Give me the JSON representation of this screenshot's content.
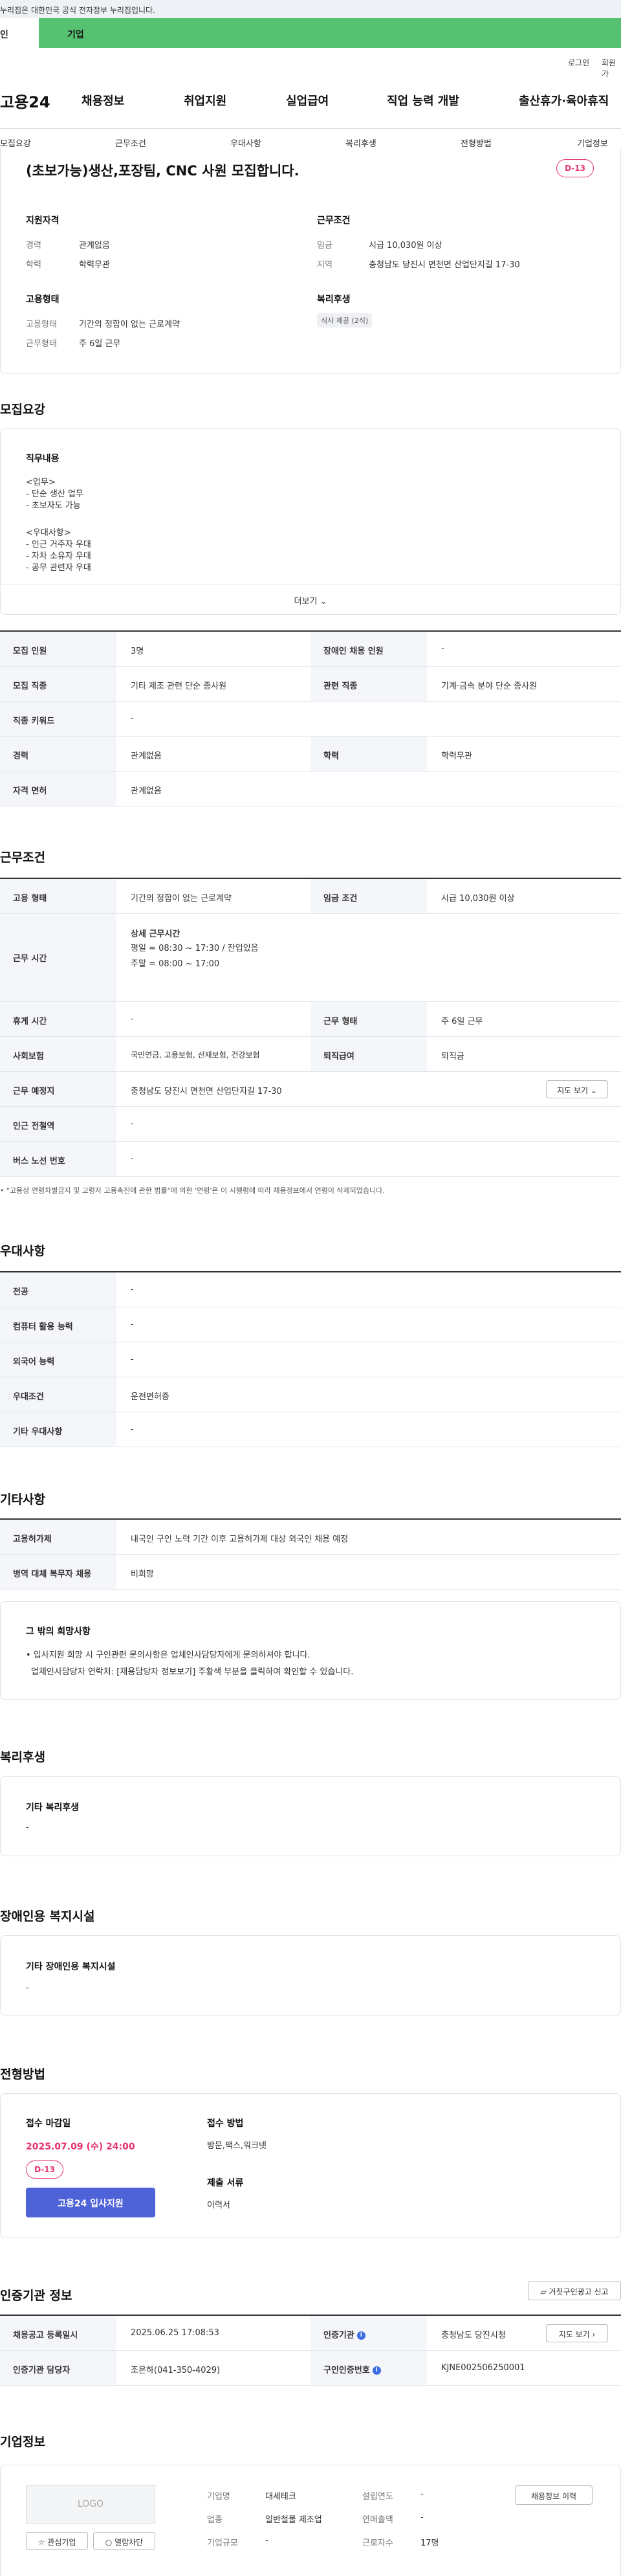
{
  "gov_banner": "이 누리집은 대한민국 공식 전자정부 누리집입니다.",
  "gov_banner_visible": "누리집은 대한민국 공식 전자정부 누리집입니다.",
  "top_tabs": [
    "인",
    "기업"
  ],
  "util_links": [
    "로그인",
    "회원가"
  ],
  "logo": "고용24",
  "gnb": [
    "채용정보",
    "취업지원",
    "실업급여",
    "직업 능력 개발",
    "출산휴가·육아휴직"
  ],
  "subnav": [
    "모집요강",
    "근무조건",
    "우대사항",
    "복리후생",
    "전형방법",
    "기업정보"
  ],
  "summary": {
    "title": "(초보가능)생산,포장팀, CNC 사원 모집합니다.",
    "dday": "D-13",
    "qual_title": "지원자격",
    "qual": [
      {
        "label": "경력",
        "value": "관계없음"
      },
      {
        "label": "학력",
        "value": "학력무관"
      }
    ],
    "cond_title": "근무조건",
    "cond": [
      {
        "label": "임금",
        "value": "시급 10,030원 이상"
      },
      {
        "label": "지역",
        "value": "충청남도 당진시 면천면 산업단지길 17-30"
      }
    ],
    "emp_title": "고용형태",
    "emp": [
      {
        "label": "고용형태",
        "value": "기간의 정함이 없는 근로계약"
      },
      {
        "label": "근무형태",
        "value": "주 6일 근무"
      }
    ],
    "welfare_title": "복리후생",
    "welfare_chip": "식사 제공 (2식)"
  },
  "recruit": {
    "section_title": "모집요강",
    "jd_title": "직무내용",
    "jd_lines": [
      "<업무>",
      "- 단순 생산 업무",
      "- 초보자도 가능",
      "",
      "<우대사항>",
      "- 인근 거주자 우대",
      "- 자차 소유자 우대",
      "- 공무 관련자 우대"
    ],
    "more_label": "더보기",
    "rows": [
      [
        {
          "h": "모집 인원",
          "v": "3명"
        },
        {
          "h": "장애인 채용 인원",
          "v": "-"
        }
      ],
      [
        {
          "h": "모집 직종",
          "v": "기타 제조 관련 단순 종사원"
        },
        {
          "h": "관련 직종",
          "v": "기계·금속 분야 단순 종사원"
        }
      ],
      [
        {
          "h": "직종 키워드",
          "v": "-"
        }
      ],
      [
        {
          "h": "경력",
          "v": "관계없음"
        },
        {
          "h": "학력",
          "v": "학력무관"
        }
      ],
      [
        {
          "h": "자격 면허",
          "v": "관계없음"
        }
      ]
    ]
  },
  "work": {
    "section_title": "근무조건",
    "emp_type_h": "고용 형태",
    "emp_type_v": "기간의 정함이 없는 근로계약",
    "wage_h": "임금 조건",
    "wage_v": "시급 10,030원 이상",
    "hours_h": "근무 시간",
    "hours_detail_title": "상세 근무시간",
    "hours_lines": [
      "평일 = 08:30 ~ 17:30 / 잔업있음",
      "주말 = 08:00 ~ 17:00"
    ],
    "rest_h": "휴게 시간",
    "rest_v": "-",
    "shift_h": "근무 형태",
    "shift_v": "주 6일 근무",
    "insurance_h": "사회보험",
    "insurance_v": "국민연금, 고용보험, 산재보험, 건강보험",
    "severance_h": "퇴직급여",
    "severance_v": "퇴직금",
    "place_h": "근무 예정지",
    "place_v": "충청남도 당진시 면천면 산업단지길 17-30",
    "map_btn": "지도 보기",
    "subway_h": "인근 전철역",
    "subway_v": "-",
    "bus_h": "버스 노선 번호",
    "bus_v": "-",
    "note": "\"고용상 연령차별금지 및 고령자 고용촉진에 관한 법률\"에 의한 '연령'은 이 시행령에 따라 채용정보에서 연령이 삭제되었습니다."
  },
  "pref": {
    "section_title": "우대사항",
    "rows": [
      {
        "h": "전공",
        "v": "-"
      },
      {
        "h": "컴퓨터 활용 능력",
        "v": "-"
      },
      {
        "h": "외국어 능력",
        "v": "-"
      },
      {
        "h": "우대조건",
        "v": "운전면허증"
      },
      {
        "h": "기타 우대사항",
        "v": "-"
      }
    ]
  },
  "etc": {
    "section_title": "기타사항",
    "rows": [
      {
        "h": "고용허가제",
        "v": "내국인 구인 노력 기간 이후 고용허가제 대상 외국인 채용 예정"
      },
      {
        "h": "병역 대체 복무자 채용",
        "v": "비희망"
      }
    ],
    "box_title": "그 밖의 희망사항",
    "box_lines": [
      "• 입사지원 희망 시 구인관련 문의사항은 업체인사담당자에게 문의하셔야 합니다.",
      "업체인사담당자 연락처: [채용담당자 정보보기] 주황색 부분을 클릭하여 확인할 수 있습니다."
    ]
  },
  "welfare": {
    "section_title": "복리후생",
    "box_title": "기타 복리후생",
    "box_value": "-"
  },
  "disability": {
    "section_title": "장애인용 복지시설",
    "box_title": "기타 장애인용 복지시설",
    "box_value": "-"
  },
  "selection": {
    "section_title": "전형방법",
    "deadline_title": "접수 마감일",
    "deadline": "2025.07.09 (수) 24:00",
    "dday": "D-13",
    "apply_btn": "고용24 입사지원",
    "method_title": "접수 방법",
    "method": "방문,팩스,워크넷",
    "docs_title": "제출 서류",
    "docs": "이력서"
  },
  "cert": {
    "section_title": "인증기관 정보",
    "report_btn": "거짓구인광고 신고",
    "reg_h": "채용공고 등록일시",
    "reg_v": "2025.06.25 17:08:53",
    "org_h": "인증기관",
    "org_v": "충청남도 당진시청",
    "map_btn": "지도 보기",
    "mgr_h": "인증기관 담당자",
    "mgr_v": "조은하(041-350-4029)",
    "no_h": "구인인증번호",
    "no_v": "KJNE002506250001"
  },
  "company": {
    "section_title": "기업정보",
    "logo_text": "LOGO",
    "btn_interest": "관심기업",
    "btn_block": "열람차단",
    "name_h": "기업명",
    "name_v": "대세테크",
    "founded_h": "설립연도",
    "founded_v": "-",
    "history_btn": "채용정보 이력",
    "industry_h": "업종",
    "industry_v": "일반철물 제조업",
    "sales_h": "연매출액",
    "sales_v": "-",
    "size_h": "기업규모",
    "size_v": "-",
    "staff_h": "근로자수",
    "staff_v": "17명"
  }
}
